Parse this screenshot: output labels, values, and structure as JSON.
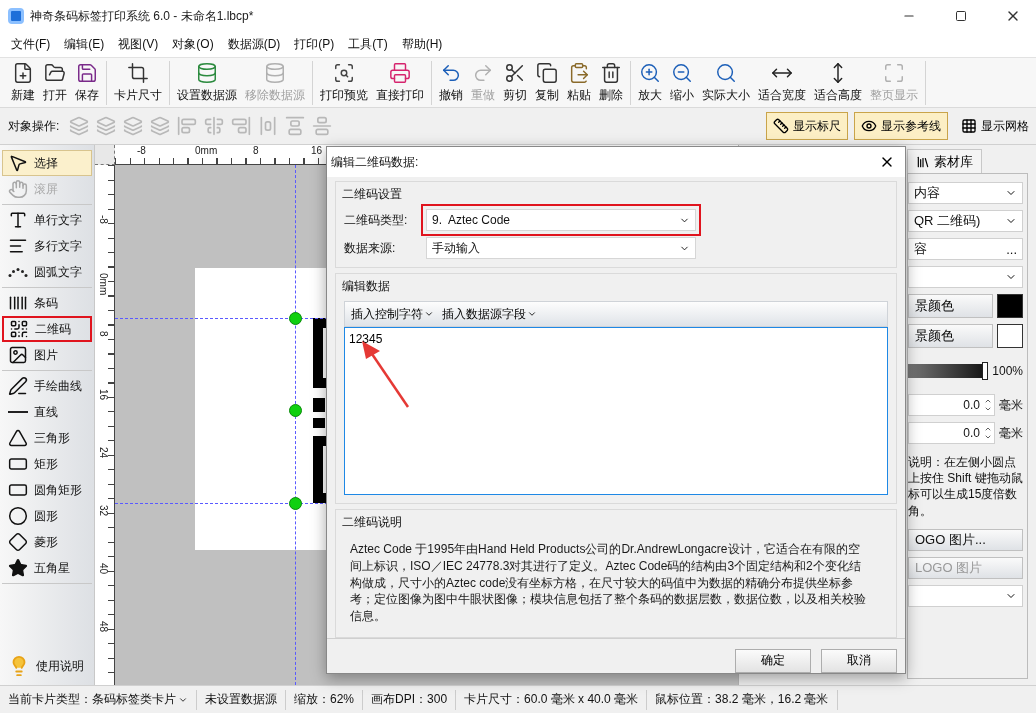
{
  "window": {
    "title": "神奇条码标签打印系统 6.0 - 未命名1.lbcp*"
  },
  "menu": [
    "文件(F)",
    "编辑(E)",
    "视图(V)",
    "对象(O)",
    "数据源(D)",
    "打印(P)",
    "工具(T)",
    "帮助(H)"
  ],
  "toolbar": [
    [
      {
        "label": "新建",
        "disabled": false
      },
      {
        "label": "打开",
        "disabled": false
      },
      {
        "label": "保存",
        "disabled": false
      }
    ],
    [
      {
        "label": "卡片尺寸",
        "disabled": false
      }
    ],
    [
      {
        "label": "设置数据源",
        "disabled": false
      },
      {
        "label": "移除数据源",
        "disabled": true
      }
    ],
    [
      {
        "label": "打印预览",
        "disabled": false
      },
      {
        "label": "直接打印",
        "disabled": false
      }
    ],
    [
      {
        "label": "撤销",
        "disabled": false
      },
      {
        "label": "重做",
        "disabled": true
      },
      {
        "label": "剪切",
        "disabled": false
      },
      {
        "label": "复制",
        "disabled": false
      },
      {
        "label": "粘贴",
        "disabled": false
      },
      {
        "label": "删除",
        "disabled": false
      }
    ],
    [
      {
        "label": "放大",
        "disabled": false
      },
      {
        "label": "缩小",
        "disabled": false
      },
      {
        "label": "实际大小",
        "disabled": false
      },
      {
        "label": "适合宽度",
        "disabled": false
      },
      {
        "label": "适合高度",
        "disabled": false
      },
      {
        "label": "整页显示",
        "disabled": true
      }
    ]
  ],
  "object_bar": {
    "label": "对象操作:",
    "toggles": [
      {
        "label": "显示标尺",
        "on": true
      },
      {
        "label": "显示参考线",
        "on": true
      },
      {
        "label": "显示网格",
        "on": false
      }
    ]
  },
  "tools": [
    [
      {
        "label": "选择",
        "selected": true,
        "disabled": false,
        "marked": false
      },
      {
        "label": "滚屏",
        "selected": false,
        "disabled": true,
        "marked": false
      }
    ],
    [
      {
        "label": "单行文字",
        "selected": false,
        "disabled": false,
        "marked": false
      },
      {
        "label": "多行文字",
        "selected": false,
        "disabled": false,
        "marked": false
      },
      {
        "label": "圆弧文字",
        "selected": false,
        "disabled": false,
        "marked": false
      }
    ],
    [
      {
        "label": "条码",
        "selected": false,
        "disabled": false,
        "marked": false
      },
      {
        "label": "二维码",
        "selected": false,
        "disabled": false,
        "marked": true
      },
      {
        "label": "图片",
        "selected": false,
        "disabled": false,
        "marked": false
      }
    ],
    [
      {
        "label": "手绘曲线",
        "selected": false,
        "disabled": false,
        "marked": false
      },
      {
        "label": "直线",
        "selected": false,
        "disabled": false,
        "marked": false
      },
      {
        "label": "三角形",
        "selected": false,
        "disabled": false,
        "marked": false
      },
      {
        "label": "矩形",
        "selected": false,
        "disabled": false,
        "marked": false
      },
      {
        "label": "圆角矩形",
        "selected": false,
        "disabled": false,
        "marked": false
      },
      {
        "label": "圆形",
        "selected": false,
        "disabled": false,
        "marked": false
      },
      {
        "label": "菱形",
        "selected": false,
        "disabled": false,
        "marked": false
      },
      {
        "label": "五角星",
        "selected": false,
        "disabled": false,
        "marked": false
      }
    ]
  ],
  "help_button": "使用说明",
  "rulers": {
    "horizontal": [
      "-8",
      "0mm",
      "8",
      "16"
    ],
    "vertical": [
      "-8",
      "0mm",
      "8",
      "16",
      "24",
      "32",
      "40",
      "48"
    ]
  },
  "dialog": {
    "title": "编辑二维码数据:",
    "settings": {
      "legend": "二维码设置",
      "fields": [
        {
          "label": "二维码类型:",
          "value": "9.  Aztec Code",
          "marked": true
        },
        {
          "label": "数据来源:",
          "value": "手动输入",
          "marked": false
        }
      ]
    },
    "edit": {
      "legend": "编辑数据",
      "menus": [
        "插入控制字符",
        "插入数据源字段"
      ],
      "value": "12345"
    },
    "info": {
      "legend": "二维码说明",
      "text": "Aztec Code 于1995年由Hand Held Products公司的Dr.AndrewLongacre设计，它适合在有限的空间上标识，ISO／IEC 24778.3对其进行了定义。Aztec Code码的结构由3个固定结构和2个变化结构做成，尺寸小的Aztec code没有坐标方格，在尺寸较大的码值中为数据的精确分布提供坐标参考；定位图像为图中牛眼状图像；模块信息包括了整个条码的数据层数，数据位数，以及相关校验信息。"
    },
    "buttons": [
      "确定",
      "取消"
    ]
  },
  "right_panel": {
    "tab": "素材库",
    "rows": [
      {
        "kind": "select",
        "value": "内容"
      },
      {
        "kind": "select",
        "value": "QR 二维码)"
      },
      {
        "kind": "picker",
        "value": "容",
        "action": "..."
      },
      {
        "kind": "select"
      },
      {
        "kind": "color",
        "label": "景颜色",
        "color": "#000000"
      },
      {
        "kind": "color",
        "label": "景颜色",
        "color": "#ffffff"
      },
      {
        "kind": "slider",
        "level": 1,
        "reading": "100%"
      },
      {
        "kind": "spin",
        "value": "0.0",
        "unit": "毫米"
      },
      {
        "kind": "spin",
        "value": "0.0",
        "unit": "毫米"
      },
      {
        "kind": "note",
        "text": "说明：在左侧小圆点上按住 Shift 键拖动鼠标可以生成15度倍数角。"
      },
      {
        "kind": "button",
        "label": "OGO 图片...",
        "disabled": false
      },
      {
        "kind": "button",
        "label": "LOGO 图片",
        "disabled": true
      },
      {
        "kind": "select"
      }
    ]
  },
  "status_bar": [
    {
      "kind": "dropdown",
      "text": "当前卡片类型：条码标签类卡片"
    },
    {
      "kind": "text",
      "text": "未设置数据源"
    },
    {
      "kind": "text",
      "text": "缩放：62%"
    },
    {
      "kind": "text",
      "text": "画布DPI：300"
    },
    {
      "kind": "text",
      "text": "卡片尺寸：60.0 毫米 x 40.0 毫米"
    },
    {
      "kind": "text",
      "text": "鼠标位置：38.2 毫米，16.2 毫米"
    }
  ]
}
